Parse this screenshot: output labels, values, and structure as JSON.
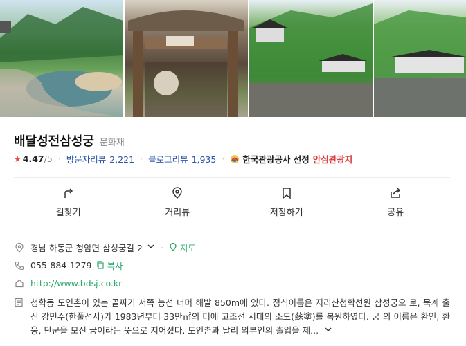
{
  "photos": [
    {
      "name": "photo-1-pond"
    },
    {
      "name": "photo-2-gate"
    },
    {
      "name": "photo-3-hall"
    },
    {
      "name": "photo-4-hall"
    }
  ],
  "place": {
    "name": "배달성전삼성궁",
    "category": "문화재",
    "rating": "4.47",
    "rating_max": "/5",
    "visitor_review_label": "방문자리뷰",
    "visitor_review_count": "2,221",
    "blog_review_label": "블로그리뷰",
    "blog_review_count": "1,935",
    "badge_text": "한국관광공사 선정",
    "badge_accent": "안심관광지"
  },
  "actions": [
    {
      "key": "directions",
      "label": "길찾기",
      "icon": "directions-icon"
    },
    {
      "key": "distance",
      "label": "거리뷰",
      "icon": "location-pin-icon"
    },
    {
      "key": "save",
      "label": "저장하기",
      "icon": "bookmark-icon"
    },
    {
      "key": "share",
      "label": "공유",
      "icon": "share-icon"
    }
  ],
  "info": {
    "address": "경남 하동군 청암면 삼성궁길 2",
    "map_label": "지도",
    "phone": "055-884-1279",
    "copy_label": "복사",
    "website": "http://www.bdsj.co.kr",
    "description": "청학동 도인촌이 있는 골짜기 서쪽 능선 너머 해발 850m에 있다. 정식이름은 지리산청학선원 삼성궁으 로, 묵계 출신 강민주(한풀선사)가 1983년부터 33만㎡의 터에 고조선 시대의 소도(蘇塗)를 복원하였다. 궁 의 이름은 환인, 환웅, 단군을 모신 궁이라는 뜻으로 지어졌다. 도인촌과 달리 외부인의 출입을 제..."
  },
  "colors": {
    "accent_green": "#2aa86b",
    "link_blue": "#2a55a8",
    "star_red": "#e94a3f"
  }
}
